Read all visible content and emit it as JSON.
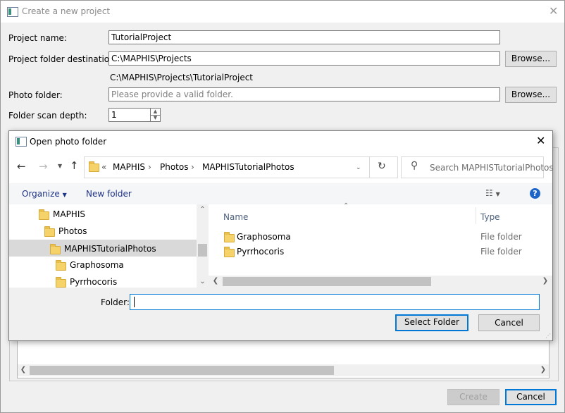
{
  "main_dialog": {
    "title": "Create a new project",
    "project_name_label": "Project name:",
    "project_name_value": "TutorialProject",
    "project_folder_label": "Project folder destination:",
    "project_folder_value": "C:\\MAPHIS\\Projects",
    "browse_label": "Browse...",
    "resolved_path": "C:\\MAPHIS\\Projects\\TutorialProject",
    "photo_folder_label": "Photo folder:",
    "photo_folder_placeholder": "Please provide a valid folder.",
    "scan_depth_label": "Folder scan depth:",
    "scan_depth_value": "1",
    "create_label": "Create",
    "cancel_label": "Cancel"
  },
  "picker": {
    "title": "Open photo folder",
    "address": {
      "prefix": "«",
      "crumbs": [
        "MAPHIS",
        "Photos",
        "MAPHISTutorialPhotos"
      ]
    },
    "search_placeholder": "Search MAPHISTutorialPhotos",
    "organize_label": "Organize",
    "new_folder_label": "New folder",
    "help_glyph": "?",
    "tree": [
      "MAPHIS",
      "Photos",
      "MAPHISTutorialPhotos",
      "Graphosoma",
      "Pyrrhocoris"
    ],
    "columns": {
      "name": "Name",
      "type": "Type"
    },
    "files": [
      {
        "name": "Graphosoma",
        "type": "File folder"
      },
      {
        "name": "Pyrrhocoris",
        "type": "File folder"
      }
    ],
    "folder_label": "Folder:",
    "folder_value": "",
    "select_label": "Select Folder",
    "cancel_label": "Cancel"
  },
  "colors": {
    "accent": "#0078d7",
    "folder": "#f5d36a",
    "help": "#1e64c8"
  }
}
